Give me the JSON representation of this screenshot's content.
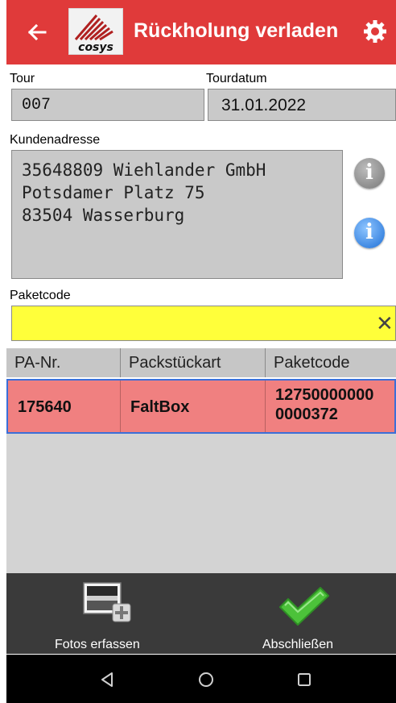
{
  "header": {
    "title": "Rückholung verladen",
    "logo_text": "cosys"
  },
  "form": {
    "tour_label": "Tour",
    "tour_value": "007",
    "date_label": "Tourdatum",
    "date_value": "31.01.2022",
    "address_label": "Kundenadresse",
    "address_lines": [
      "35648809 Wiehlander GmbH",
      "Potsdamer Platz 75",
      "83504 Wasserburg"
    ],
    "package_label": "Paketcode",
    "package_value": "",
    "clear_symbol": "✕"
  },
  "table": {
    "columns": [
      "PA-Nr.",
      "Packstückart",
      "Paketcode"
    ],
    "rows": [
      {
        "pa_nr": "175640",
        "packstueckart": "FaltBox",
        "paketcode_line1": "12750000000",
        "paketcode_line2": "0000372"
      }
    ]
  },
  "actions": {
    "photos_label": "Fotos erfassen",
    "finish_label": "Abschließen"
  },
  "colors": {
    "header_bg": "#e03a3a",
    "input_highlight": "#ffff3a",
    "selected_row": "#f08080",
    "selected_border": "#3b6fd8",
    "action_bar": "#3a3a3a",
    "check_green": "#4cc23a"
  },
  "icons": [
    "back-arrow-icon",
    "cosys-logo",
    "gear-icon",
    "info-icon",
    "info-blue-icon",
    "clear-icon",
    "photo-add-icon",
    "checkmark-icon",
    "nav-back-icon",
    "nav-home-icon",
    "nav-recents-icon"
  ]
}
